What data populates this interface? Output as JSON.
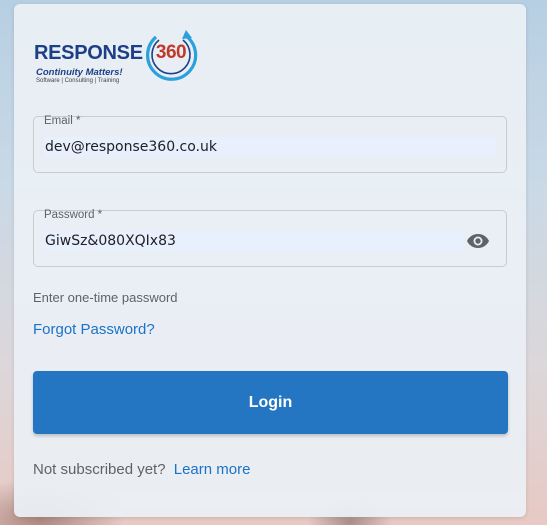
{
  "logo": {
    "word": "RESPONSE",
    "number": "360",
    "tagline": "Continuity Matters!",
    "sub": "Software | Consulting | Training",
    "colors": {
      "navy": "#1d3f87",
      "ring": "#2aa0dc",
      "number": "#c0392b"
    }
  },
  "form": {
    "email": {
      "label": "Email *",
      "value": "dev@response360.co.uk"
    },
    "password": {
      "label": "Password *",
      "value": "GiwSz&080XQIx83",
      "toggle_icon": "eye-icon"
    },
    "otp_text": "Enter one-time password",
    "forgot_link": "Forgot Password?",
    "login_label": "Login"
  },
  "footer": {
    "text": "Not subscribed yet?",
    "link": "Learn more"
  },
  "colors": {
    "accent": "#2476c3",
    "link": "#1a73c8",
    "autofill": "#e8f0fe"
  }
}
